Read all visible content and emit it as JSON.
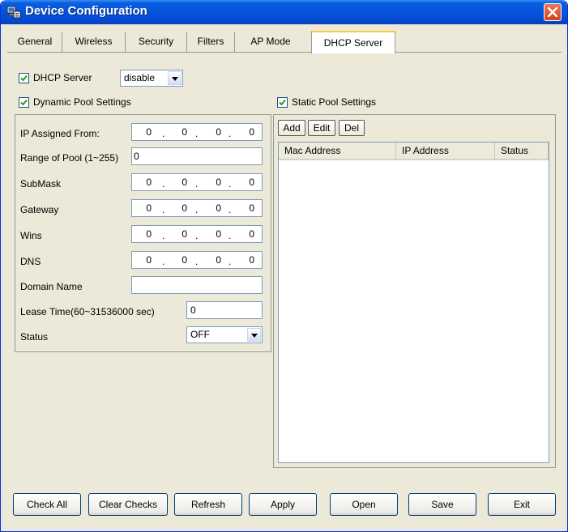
{
  "window": {
    "title": "Device Configuration"
  },
  "tabs": [
    {
      "label": "General"
    },
    {
      "label": "Wireless"
    },
    {
      "label": "Security"
    },
    {
      "label": "Filters"
    },
    {
      "label": "AP Mode"
    },
    {
      "label": "DHCP Server",
      "active": true
    }
  ],
  "dhcp": {
    "label": "DHCP Server",
    "checked": true,
    "mode_value": "disable"
  },
  "dynamic_pool": {
    "label": "Dynamic Pool Settings",
    "checked": true,
    "fields": {
      "ip_from": {
        "label": "IP Assigned From:",
        "octets": [
          "0",
          "0",
          "0",
          "0"
        ]
      },
      "range": {
        "label": "Range of Pool (1~255)",
        "value": "0"
      },
      "submask": {
        "label": "SubMask",
        "octets": [
          "0",
          "0",
          "0",
          "0"
        ]
      },
      "gateway": {
        "label": "Gateway",
        "octets": [
          "0",
          "0",
          "0",
          "0"
        ]
      },
      "wins": {
        "label": "Wins",
        "octets": [
          "0",
          "0",
          "0",
          "0"
        ]
      },
      "dns": {
        "label": "DNS",
        "octets": [
          "0",
          "0",
          "0",
          "0"
        ]
      },
      "domain": {
        "label": "Domain Name",
        "value": ""
      },
      "lease": {
        "label": "Lease Time(60~31536000 sec)",
        "value": "0"
      },
      "status": {
        "label": "Status",
        "value": "OFF"
      }
    }
  },
  "static_pool": {
    "label": "Static Pool Settings",
    "checked": true,
    "buttons": {
      "add": "Add",
      "edit": "Edit",
      "del": "Del"
    },
    "columns": [
      "Mac Address",
      "IP Address",
      "Status"
    ]
  },
  "footer": {
    "check_all": "Check All",
    "clear_checks": "Clear Checks",
    "refresh": "Refresh",
    "apply": "Apply",
    "open": "Open",
    "save": "Save",
    "exit": "Exit"
  },
  "colors": {
    "titlebar": "#0553dd",
    "window_bg": "#ece9d8",
    "active_tab_accent": "#ffc83c",
    "close_button": "#d0431e"
  }
}
